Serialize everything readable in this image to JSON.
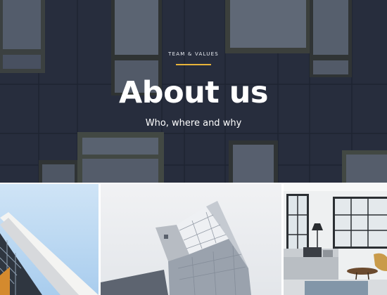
{
  "hero": {
    "eyebrow": "TEAM & VALUES",
    "title": "About us",
    "subtitle": "Who, where and why",
    "accent_color": "#e8b43a",
    "background_color": "#2b3344"
  },
  "gallery": {
    "images": [
      {
        "subject": "building-roof-sky"
      },
      {
        "subject": "angular-glass-building"
      },
      {
        "subject": "loft-living-room"
      }
    ]
  }
}
